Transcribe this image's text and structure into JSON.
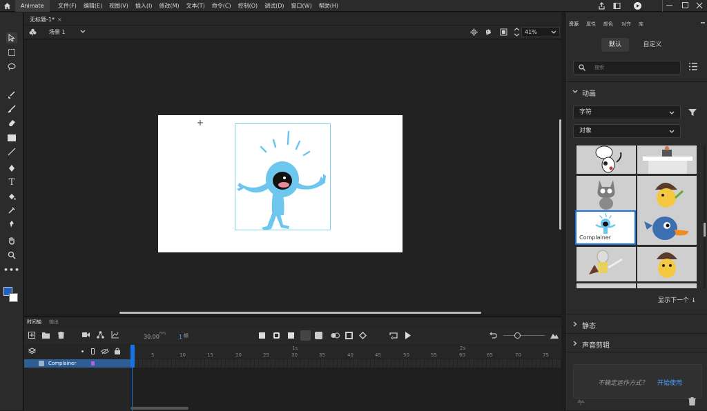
{
  "app": {
    "name": "Animate"
  },
  "menu": [
    "文件(F)",
    "编辑(E)",
    "视图(V)",
    "插入(I)",
    "修改(M)",
    "文本(T)",
    "命令(C)",
    "控制(O)",
    "调试(D)",
    "窗口(W)",
    "帮助(H)"
  ],
  "document": {
    "tab_title": "无标题-1*",
    "scene": "场景 1",
    "zoom": "41%"
  },
  "timeline": {
    "tabs": [
      "时间轴",
      "输出"
    ],
    "fps": "30.00",
    "fps_unit": "FPS",
    "frame": "1",
    "frame_unit": "帧",
    "layer_name": "Complainer",
    "seconds": [
      "1s",
      "2s"
    ],
    "frame_numbers": [
      "5",
      "10",
      "15",
      "20",
      "25",
      "30",
      "35",
      "40",
      "45",
      "50",
      "55",
      "60",
      "65",
      "70",
      "75"
    ]
  },
  "panel": {
    "tabs": [
      "资源",
      "属性",
      "颜色",
      "对齐",
      "库"
    ],
    "toggle": [
      "默认",
      "自定义"
    ],
    "search_placeholder": "搜索",
    "animation_section": "动画",
    "category_select": "字符",
    "type_select": "对象",
    "selected_asset_label": "Complainer",
    "show_next": "显示下一个",
    "static_section": "静态",
    "sound_section": "声音剪辑",
    "help_text": "不确定运作方式？",
    "help_link": "开始使用"
  },
  "colors": {
    "accent": "#1473e6",
    "stroke": "#1e5fc4",
    "fill": "#ffffff",
    "character": "#6cc6ee"
  }
}
